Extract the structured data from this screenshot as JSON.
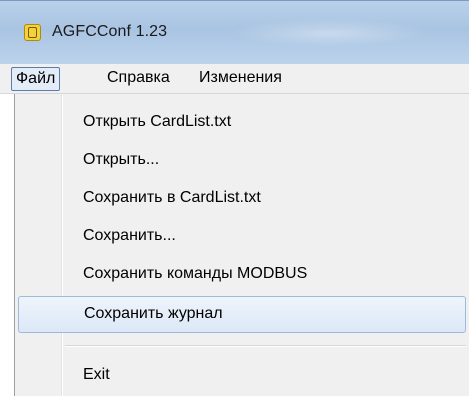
{
  "window": {
    "title": "AGFCConf 1.23",
    "app_icon": "app-logo-icon"
  },
  "menubar": {
    "items": [
      {
        "label": "Файл",
        "active": true
      },
      {
        "label": "Справка",
        "active": false
      },
      {
        "label": "Изменения",
        "active": false
      }
    ]
  },
  "file_menu": {
    "items": [
      {
        "label": "Открыть CardList.txt"
      },
      {
        "label": "Открыть..."
      },
      {
        "label": "Сохранить в CardList.txt"
      },
      {
        "label": "Сохранить..."
      },
      {
        "label": "Сохранить команды MODBUS"
      },
      {
        "label": "Сохранить журнал",
        "highlighted": true
      },
      {
        "label": "Exit"
      }
    ]
  },
  "colors": {
    "titlebar": "#b9d1ea",
    "menu_background": "#f0f0f0",
    "highlight_border": "#9fb9da"
  }
}
